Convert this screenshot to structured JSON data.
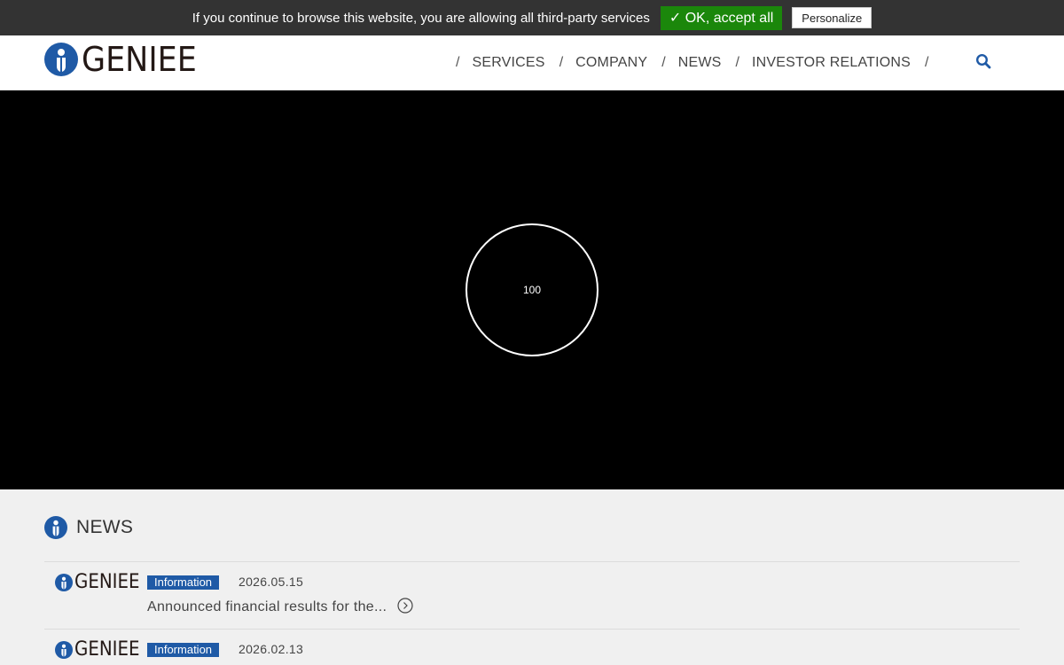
{
  "cookie_bar": {
    "message": "If you continue to browse this website, you are allowing all third-party services",
    "accept_label": "✓ OK, accept all",
    "personalize_label": "Personalize"
  },
  "header": {
    "logo_text": "GENIEE",
    "nav": [
      {
        "label": "SERVICES"
      },
      {
        "label": "COMPANY"
      },
      {
        "label": "NEWS"
      },
      {
        "label": "INVESTOR RELATIONS"
      }
    ],
    "separator": "/",
    "search_icon": "search-icon"
  },
  "hero": {
    "loader_value": "100"
  },
  "news": {
    "title": "NEWS",
    "items": [
      {
        "brand": "GENIEE",
        "category": "Information",
        "date": "2026.05.15",
        "headline": "Announced financial results for the..."
      },
      {
        "brand": "GENIEE",
        "category": "Information",
        "date": "2026.02.13",
        "headline": ""
      }
    ]
  },
  "colors": {
    "brand_blue": "#1f5aa6",
    "accept_green": "#1b870b",
    "cookie_bg": "#333333",
    "news_bg": "#f0f0f0"
  }
}
